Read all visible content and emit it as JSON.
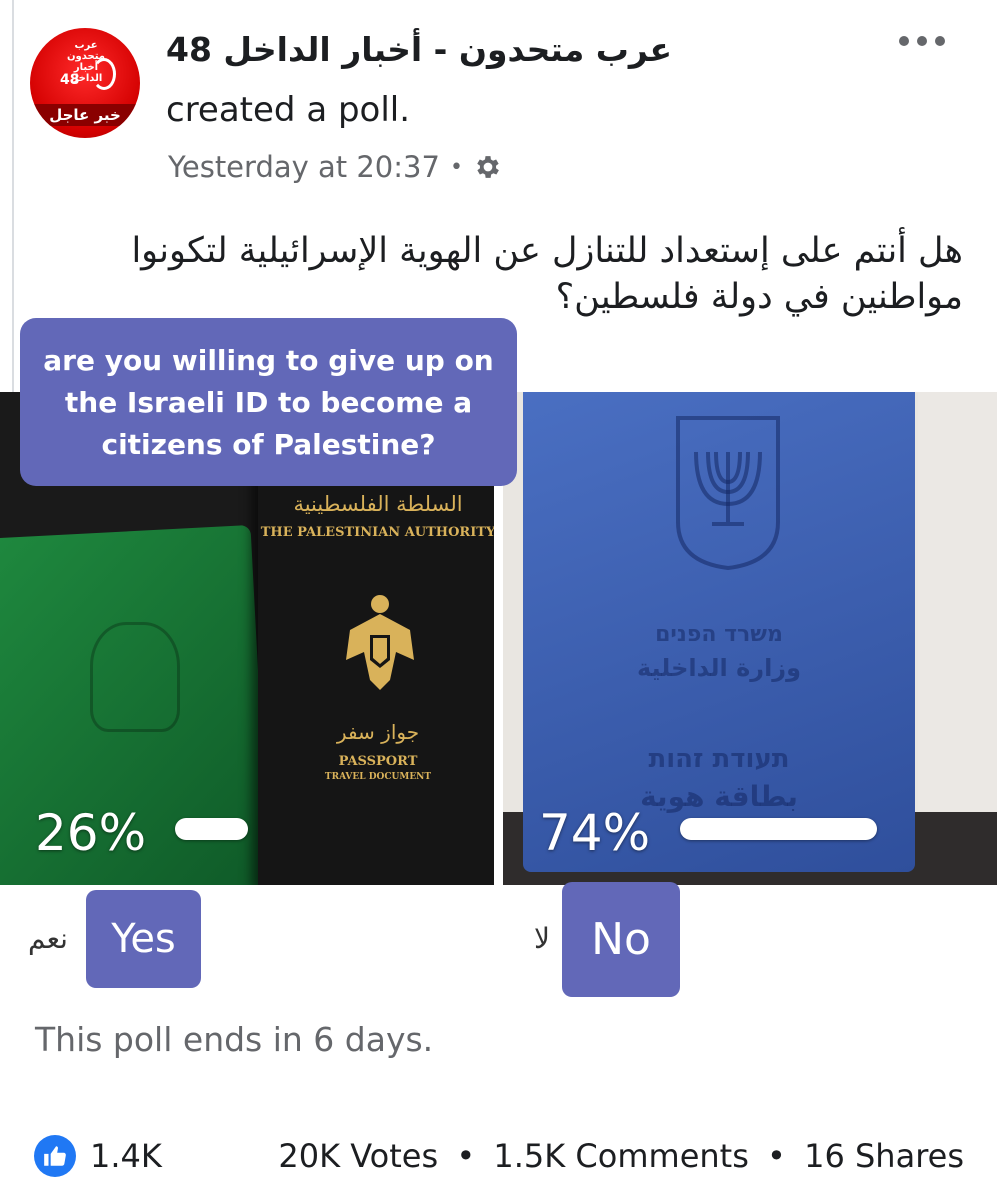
{
  "post": {
    "page_name": "عرب متحدون - أخبار الداخل 48",
    "action": "created a poll.",
    "timestamp": "Yesterday at 20:37",
    "separator": "•",
    "privacy_icon": "gear-icon",
    "avatar": {
      "logo_top": "عرب متحدون أخبار الداخل",
      "logo_number": "48",
      "banner_text": "خبر عاجل"
    },
    "question_ar": "هل أنتم على إستعداد للتنازل عن الهوية الإسرائيلية لتكونوا مواطنين في دولة فلسطين؟"
  },
  "poll": {
    "question_en": "are you willing to give up on the Israeli ID to become a citizens of Palestine?",
    "options": [
      {
        "percent_label": "26%",
        "percent": 26,
        "label": "Yes",
        "label_ar": "نعم",
        "image": {
          "authority_ar": "السلطة الفلسطينية",
          "authority_en": "THE PALESTINIAN AUTHORITY",
          "passport_ar": "جواز سفر",
          "passport_en": "PASSPORT",
          "travel_doc": "TRAVEL DOCUMENT"
        }
      },
      {
        "percent_label": "74%",
        "percent": 74,
        "label": "No",
        "label_ar": "لا",
        "image": {
          "ministry_he": "משרד הפנים",
          "ministry_ar": "وزارة الداخلية",
          "id_he": "תעודת זהות",
          "id_ar": "بطاقة هوية"
        }
      }
    ],
    "ends_text": "This poll ends in 6 days."
  },
  "footer": {
    "reactions": "1.4K",
    "votes": "20K Votes",
    "comments": "1.5K Comments",
    "shares": "16 Shares",
    "dot": "•"
  },
  "colors": {
    "accent": "#6268b8",
    "like_blue": "#2078f4",
    "meta_gray": "#65676b"
  }
}
